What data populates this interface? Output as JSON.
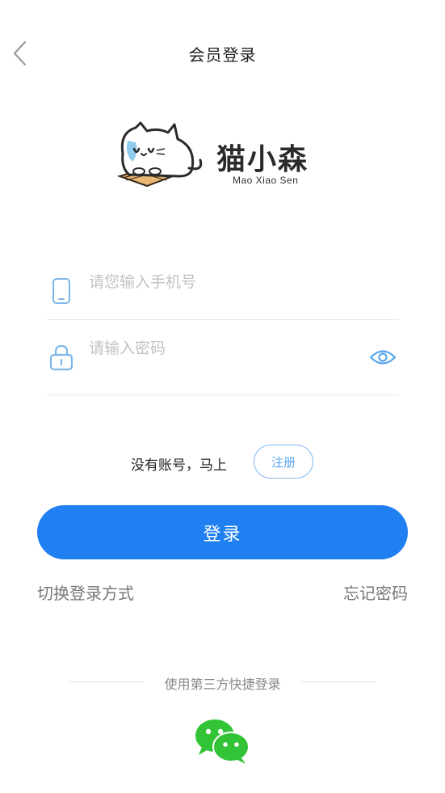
{
  "header": {
    "title": "会员登录",
    "back_icon": "chevron-left-icon"
  },
  "logo": {
    "name": "猫小森",
    "subtitle": "Mao Xiao Sen"
  },
  "phone": {
    "placeholder": "请您输入手机号",
    "value": ""
  },
  "password": {
    "placeholder": "请输入密码",
    "value": ""
  },
  "register": {
    "prompt": "没有账号，马上",
    "button_label": "注册"
  },
  "login": {
    "button_label": "登录"
  },
  "links": {
    "switch_login": "切换登录方式",
    "forgot_password": "忘记密码"
  },
  "third_party": {
    "label": "使用第三方快捷登录"
  },
  "colors": {
    "primary": "#2080f2",
    "accent_light": "#5aa6ec",
    "wechat": "#33c336"
  }
}
